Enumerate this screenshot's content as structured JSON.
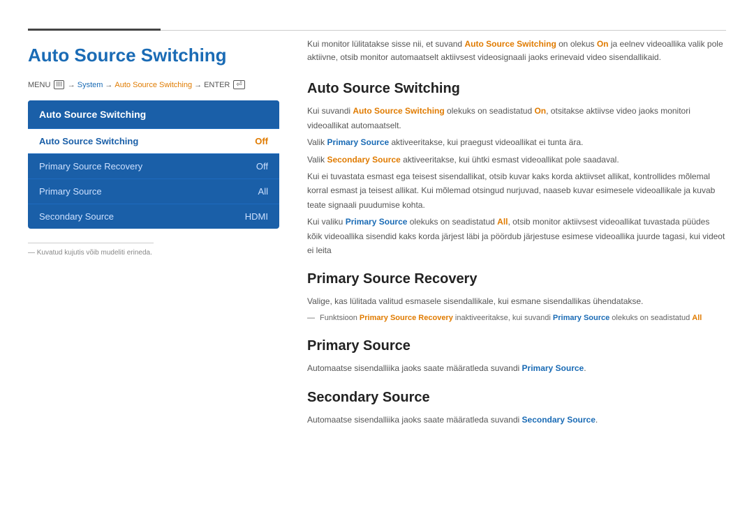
{
  "header": {
    "title": "Auto Source Switching",
    "topBorderDark": true
  },
  "menuPath": {
    "menu": "MENU",
    "menuIconLabel": "III",
    "arrow1": "→",
    "system": "System",
    "arrow2": "→",
    "autoSource": "Auto Source Switching",
    "arrow3": "→",
    "enter": "ENTER"
  },
  "menuBox": {
    "title": "Auto Source Switching",
    "items": [
      {
        "label": "Auto Source Switching",
        "value": "Off",
        "selected": true
      },
      {
        "label": "Primary Source Recovery",
        "value": "Off",
        "selected": false
      },
      {
        "label": "Primary Source",
        "value": "All",
        "selected": false
      },
      {
        "label": "Secondary Source",
        "value": "HDMI",
        "selected": false
      }
    ]
  },
  "footnote": {
    "divider": true,
    "text": "— Kuvatud kujutis võib mudeliti erineda."
  },
  "introText": "Kui monitor lülitatakse sisse nii, et suvand Auto Source Switching on olekus On ja eelnev videoallika valik pole aktiivne, otsib monitor automaatselt aktiivsest videosignaali jaoks erinevaid video sisendallikaid.",
  "sections": [
    {
      "id": "auto-source-switching",
      "heading": "Auto Source Switching",
      "paragraphs": [
        "Kui suvandi Auto Source Switching olekuks on seadistatud On, otsitakse aktiivse video jaoks monitori videoallikat automaatselt.",
        "Valik Primary Source aktiveeritakse, kui praegust videoallikat ei tunta ära.",
        "Valik Secondary Source aktiveeritakse, kui ühtki esmast videoallikat pole saadaval.",
        "Kui ei tuvastata esmast ega teisest sisendallikat, otsib kuvar kaks korda aktiivset allikat, kontrollides mõlemal korral esmast ja teisest allikat. Kui mõlemad otsingud nurjuvad, naaseb kuvar esimesele videoallikale ja kuvab teate signaali puudumise kohta.",
        "Kui valiku Primary Source olekuks on seadistatud All, otsib monitor aktiivsest videoallikat tuvastada püüdes kõik videoallika sisendid kaks korda järjest läbi ja pöördub järjestuse esimese videoallika juurde tagasi, kui videot ei leita"
      ],
      "highlights": {
        "Auto Source Switching": "orange",
        "On": "orange",
        "Primary Source": "blue",
        "Secondary Source": "orange",
        "All": "orange"
      }
    },
    {
      "id": "primary-source-recovery",
      "heading": "Primary Source Recovery",
      "paragraphs": [
        "Valige, kas lülitada valitud esmasele sisendallikale, kui esmane sisendallikas ühendatakse.",
        "— Funktsioon Primary Source Recovery inaktiveeritakse, kui suvandi Primary Source olekuks on seadistatud All"
      ]
    },
    {
      "id": "primary-source",
      "heading": "Primary Source",
      "paragraphs": [
        "Automaatse sisendalliika jaoks saate määratleda suvandi Primary Source."
      ]
    },
    {
      "id": "secondary-source",
      "heading": "Secondary Source",
      "paragraphs": [
        "Automaatse sisendalliika jaoks saate määratleda suvandi Secondary Source."
      ]
    }
  ]
}
